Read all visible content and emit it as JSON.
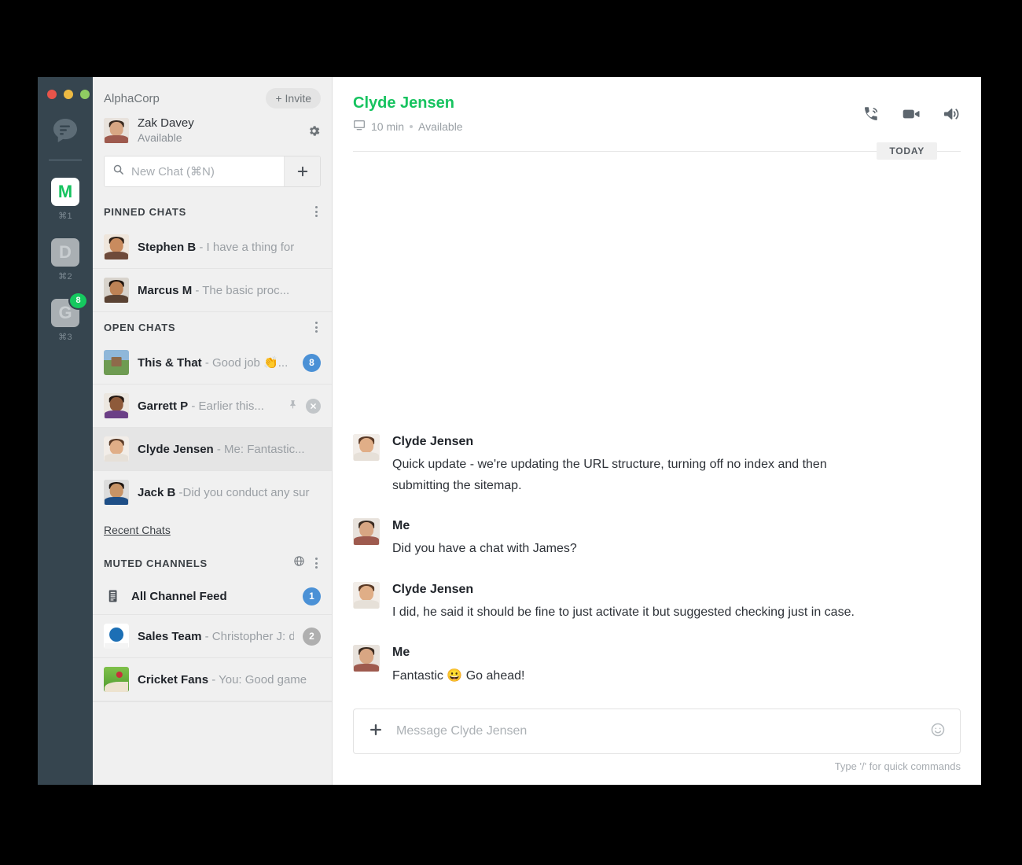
{
  "window": {
    "traffic_lights": [
      "close",
      "minimize",
      "zoom"
    ]
  },
  "rail": {
    "logo_icon": "chat-bubble-logo",
    "workspaces": [
      {
        "letter": "M",
        "shortcut": "⌘1",
        "active": true,
        "badge": ""
      },
      {
        "letter": "D",
        "shortcut": "⌘2",
        "active": false,
        "badge": ""
      },
      {
        "letter": "G",
        "shortcut": "⌘3",
        "active": false,
        "badge": "8"
      }
    ]
  },
  "sidebar": {
    "org_name": "AlphaCorp",
    "invite_label": "+ Invite",
    "me": {
      "name": "Zak Davey",
      "status": "Available",
      "settings_icon": "gear-icon"
    },
    "search": {
      "placeholder": "New Chat (⌘N)",
      "search_icon": "search-icon",
      "add_icon": "plus-icon"
    },
    "sections": [
      {
        "title": "PINNED CHATS",
        "menu_icon": "kebab-icon",
        "rows": [
          {
            "name": "Stephen B",
            "preview": "- I have a thing for",
            "badge": "",
            "avatar": "av-stephen"
          },
          {
            "name": "Marcus M",
            "preview": "- The basic proc...",
            "badge": "",
            "avatar": "av-marcus"
          }
        ]
      },
      {
        "title": "OPEN CHATS",
        "menu_icon": "kebab-icon",
        "rows": [
          {
            "name": "This & That",
            "preview": "- Good job 👏...",
            "badge": "8",
            "badge_color": "blue",
            "avatar": "av-thisthat"
          },
          {
            "name": "Garrett P",
            "preview": "- Earlier this...",
            "badge": "",
            "avatar": "av-garrett",
            "actions": [
              "pin-icon",
              "close-icon"
            ]
          },
          {
            "name": "Clyde Jensen",
            "preview": "- Me: Fantastic...",
            "badge": "",
            "avatar": "av-clyde",
            "selected": true
          },
          {
            "name": "Jack B",
            "preview": "-Did you conduct any sur",
            "badge": "",
            "avatar": "av-jack"
          }
        ]
      }
    ],
    "recent_chats_label": "Recent Chats",
    "muted": {
      "title": "MUTED CHANNELS",
      "globe_icon": "globe-icon",
      "menu_icon": "kebab-icon",
      "rows": [
        {
          "name": "All Channel Feed",
          "preview": "",
          "badge": "1",
          "badge_color": "blue",
          "icon": "feed-icon"
        },
        {
          "name": "Sales Team",
          "preview": "- Christopher J: d.",
          "badge": "2",
          "badge_color": "gray",
          "avatar": "av-sales"
        },
        {
          "name": "Cricket Fans",
          "preview": "- You: Good game",
          "badge": "",
          "avatar": "av-cricket"
        }
      ]
    }
  },
  "conversation": {
    "peer_name": "Clyde Jensen",
    "presence_icon": "monitor-icon",
    "idle_time": "10 min",
    "presence_status": "Available",
    "actions": [
      {
        "icon": "phone-call-icon",
        "label": "Call"
      },
      {
        "icon": "video-camera-icon",
        "label": "Video"
      },
      {
        "icon": "speaker-icon",
        "label": "Audio"
      }
    ],
    "date_divider": "TODAY",
    "messages": [
      {
        "author": "Clyde Jensen",
        "avatar": "av-clyde",
        "text": "Quick update -  we're updating the URL structure, turning off no index and then submitting the sitemap."
      },
      {
        "author": "Me",
        "avatar": "av-zak",
        "text": "Did you have a chat with James?"
      },
      {
        "author": "Clyde Jensen",
        "avatar": "av-clyde",
        "text": "I did, he said it should be fine to just activate it but suggested checking just in case."
      },
      {
        "author": "Me",
        "avatar": "av-zak",
        "text": "Fantastic 😀 Go ahead!"
      }
    ],
    "composer": {
      "add_icon": "plus-icon",
      "placeholder": "Message Clyde Jensen",
      "emoji_icon": "smiley-icon"
    },
    "hint": "Type '/' for quick commands"
  },
  "colors": {
    "rail_bg": "#36454F",
    "accent_green": "#16C35F",
    "badge_blue": "#4B91D6",
    "badge_gray": "#AFAFAF",
    "sidebar_bg": "#F0F0F0"
  }
}
